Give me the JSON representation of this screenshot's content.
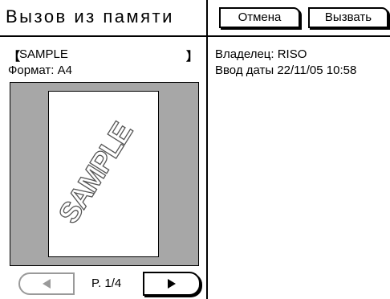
{
  "header": {
    "title": "Вызов из памяти",
    "cancel_label": "Отмена",
    "recall_label": "Вызвать"
  },
  "file": {
    "bracket_open": "【",
    "name": "SAMPLE",
    "bracket_close": "】",
    "format": "Формат: A4",
    "owner": "Владелец: RISO",
    "date": "Ввод даты  22/11/05    10:58"
  },
  "preview": {
    "watermark": "SAMPLE"
  },
  "pager": {
    "page_label": "P. 1/4",
    "prev_icon": "left-triangle-icon",
    "next_icon": "right-triangle-icon"
  }
}
